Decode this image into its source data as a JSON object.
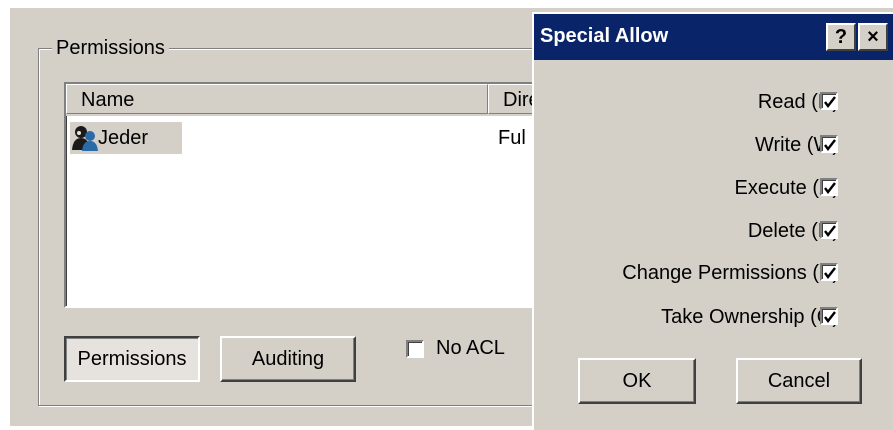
{
  "permissions_group": {
    "title": "Permissions",
    "list": {
      "columns": [
        "Name",
        "Dire"
      ],
      "rows": [
        {
          "name": "Jeder",
          "access": "Ful",
          "icon": "users-icon"
        }
      ]
    },
    "buttons": {
      "permissions": "Permissions",
      "auditing": "Auditing"
    },
    "no_acl": {
      "label": "No ACL",
      "checked": false
    }
  },
  "dialog": {
    "title": "Special Allow",
    "help_label": "?",
    "close_label": "×",
    "permissions": [
      {
        "label": "Read (R)",
        "checked": true
      },
      {
        "label": "Write (W)",
        "checked": true
      },
      {
        "label": "Execute (X)",
        "checked": true
      },
      {
        "label": "Delete (D)",
        "checked": true
      },
      {
        "label": "Change Permissions (P)",
        "checked": true
      },
      {
        "label": "Take Ownership (O)",
        "checked": true
      }
    ],
    "ok_label": "OK",
    "cancel_label": "Cancel"
  },
  "colors": {
    "titlebar": "#0a246a",
    "face": "#d4d0c8"
  }
}
